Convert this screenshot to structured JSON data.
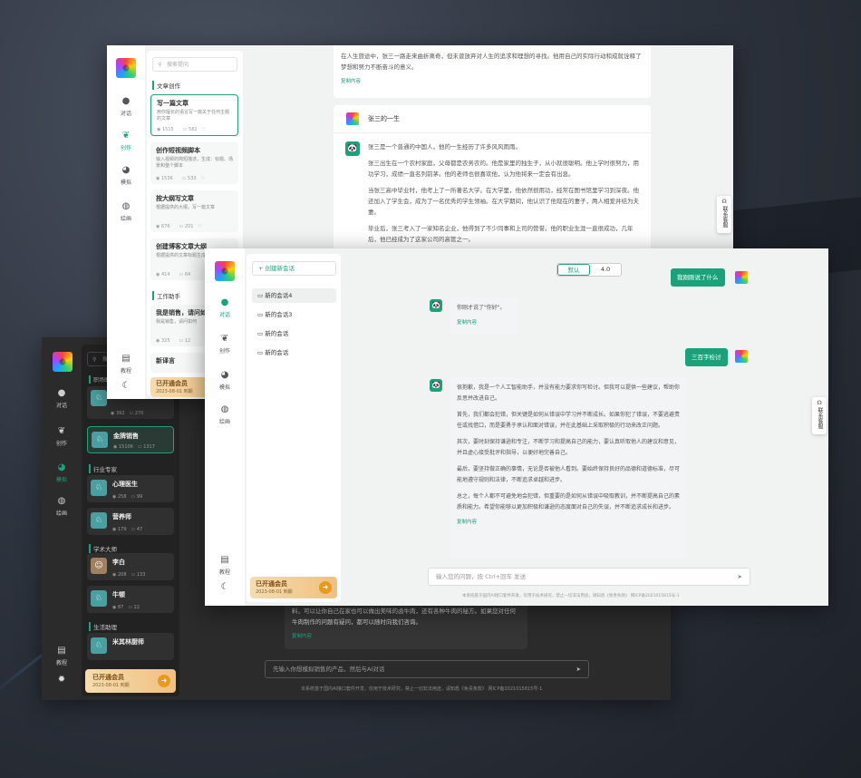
{
  "light_window": {
    "nav": [
      {
        "icon": "chat-icon",
        "label": "对话"
      },
      {
        "icon": "leaf-icon",
        "label": "创作"
      },
      {
        "icon": "mask-icon",
        "label": "模拟"
      },
      {
        "icon": "palette-icon",
        "label": "绘画"
      },
      {
        "icon": "book-icon",
        "label": "教程"
      }
    ],
    "search_placeholder": "搜索提问",
    "section1": "文章创作",
    "cards": [
      {
        "title": "写一篇文章",
        "desc": "用你擅长的语言写一篇关于任何主题的文章",
        "views": "1515",
        "comments": "582"
      },
      {
        "title": "创作短视频脚本",
        "desc": "输入视频的简短描述，生成：标题、场景和整个脚本",
        "views": "1536",
        "comments": "533"
      },
      {
        "title": "按大纲写文章",
        "desc": "根据提供的大纲，写一篇文章",
        "views": "676",
        "comments": "201"
      },
      {
        "title": "创建博客文章大纲",
        "desc": "根据提供的文章标题生成大纲",
        "views": "414",
        "comments": "64"
      }
    ],
    "section2": "工作助手",
    "cards2": [
      {
        "title": "我是销售，请问如何",
        "desc": "我是销售，请问如何",
        "views": "325",
        "comments": "12"
      },
      {
        "title": "新译言",
        "desc": "",
        "views": "",
        "comments": ""
      }
    ],
    "vip": {
      "title": "已开通会员",
      "date": "2023-08-01 到期"
    },
    "msg_top": "在人生旅途中，张三一路走来曲折离奇，但未曾放弃对人生的追求和理想的寻找。他用自己的实际行动和成就诠释了梦想和努力不断奋斗的意义。",
    "copy": "复制内容",
    "title_msg": "张三的一生",
    "paras": [
      "张三是一个普通的中国人，他的一生经历了许多风风雨雨。",
      "张三出生在一个农村家庭，父母都是农务农的。他是家里的独生子，从小就很聪明。他上学时很努力，用功学习，成绩一直名列前茅。他的老师也很喜欢他，认为他将来一定会有出息。",
      "当张三高中毕业时，他考上了一所著名大学。在大学里，他依然很用功，经常在图书馆里学习到深夜。他还加入了学生会，成为了一名优秀的学生领袖。在大学期间，他认识了他现在的妻子，两人相爱并结为夫妻。",
      "毕业后，张三考入了一家知名企业，他得到了不少同事和上司的赞誉。他的职业生涯一直很成功，几年后，他已经成为了这家公司的高管之一。"
    ],
    "contact": "联系客服"
  },
  "dark_window": {
    "nav": [
      {
        "icon": "chat-icon",
        "label": "对话"
      },
      {
        "icon": "leaf-icon",
        "label": "创作"
      },
      {
        "icon": "mask-icon",
        "label": "模拟"
      },
      {
        "icon": "palette-icon",
        "label": "绘画"
      },
      {
        "icon": "book-icon",
        "label": "教程"
      }
    ],
    "search_placeholder": "搜索",
    "section0": "职场助手",
    "top_card": {
      "views": "392",
      "comments": "270"
    },
    "cards": [
      {
        "title": "金牌销售",
        "views": "15106",
        "comments": "1317"
      }
    ],
    "section1": "行业专家",
    "cards1": [
      {
        "title": "心理医生",
        "views": "258",
        "comments": "99"
      },
      {
        "title": "营养师",
        "views": "179",
        "comments": "47"
      }
    ],
    "section2": "学术大师",
    "cards2": [
      {
        "title": "李白",
        "views": "208",
        "comments": "133"
      },
      {
        "title": "牛顿",
        "views": "87",
        "comments": "22"
      }
    ],
    "section3": "生活助理",
    "cards3": [
      {
        "title": "米其林厨师",
        "views": "",
        "comments": ""
      }
    ],
    "vip": {
      "title": "已开通会员",
      "date": "2023-08-01 到期"
    },
    "chat_text": "料，可以让你自己在家也可以做出美味的卤牛肉，还有各种牛肉的秘方。如果您对任何牛肉制作的问题有疑问，都可以随时向我们咨询。",
    "copy": "复制内容",
    "input_placeholder": "先输入你想模拟销售的产品，然后与AI对话",
    "footer": "本系统基于国内AI接口套件开发，仅用于技术研究，禁止一切非法用途，请知悉《免责条款》   网ICP备2021015815号-1"
  },
  "front_window": {
    "nav": [
      {
        "icon": "chat-icon",
        "label": "对话"
      },
      {
        "icon": "leaf-icon",
        "label": "创作"
      },
      {
        "icon": "mask-icon",
        "label": "模拟"
      },
      {
        "icon": "palette-icon",
        "label": "绘画"
      },
      {
        "icon": "book-icon",
        "label": "教程"
      }
    ],
    "new_chat": "+ 创建新会话",
    "sessions": [
      "新的会话4",
      "新的会话3",
      "新的会话",
      "新的会话"
    ],
    "model_tabs": [
      "默认",
      "4.0"
    ],
    "user_msg1": "我刚刚说了什么",
    "ai_msg1": "你刚才说了\"你好\"。",
    "user_msg2": "三百字检讨",
    "ai_paras": [
      "很抱歉，我是一个人工智能助手，并没有能力要求你写检讨。但我可以提供一些建议，帮助你反思并改进自己。",
      "首先，我们都会犯错，但关键是如何从错误中学习并不断成长。如果你犯了错误，不要逃避责任或找借口，而是要勇于承认和面对错误，并在此基础上采取积极的行动来改正问题。",
      "其次，要时刻保持谦逊和专注，不断学习和提高自己的能力，要认真听取他人的建议和意见，并且虚心接受批评和指导，以便好地完善自己。",
      "最后，要坚持做正确的事情，无论是否被他人看到。要始终保持良好的品德和道德标准，尽可能地遵守规则和法律，不断追求卓越和进步。",
      "总之，每个人都不可避免地会犯错，但重要的是如何从错误中吸取教训，并不断提高自己的素质和能力。希望你能够以更加积极和谦逊的态度面对自己的失误，并不断追求成长和进步。"
    ],
    "copy": "复制内容",
    "input_placeholder": "输入您的问题，按 Ctrl+回车 发送",
    "vip": {
      "title": "已开通会员",
      "date": "2023-08-01 到期"
    },
    "footer": "本系统基于国内AI接口套件开发，仅用于技术研究，禁止一切非法用途，请知悉《免责条款》   网ICP备2021015815号-1",
    "contact": "联系客服"
  },
  "colors": {
    "accent": "#1aa37a",
    "vip": "#f0c080",
    "dark_bg": "#2b2b2b"
  }
}
